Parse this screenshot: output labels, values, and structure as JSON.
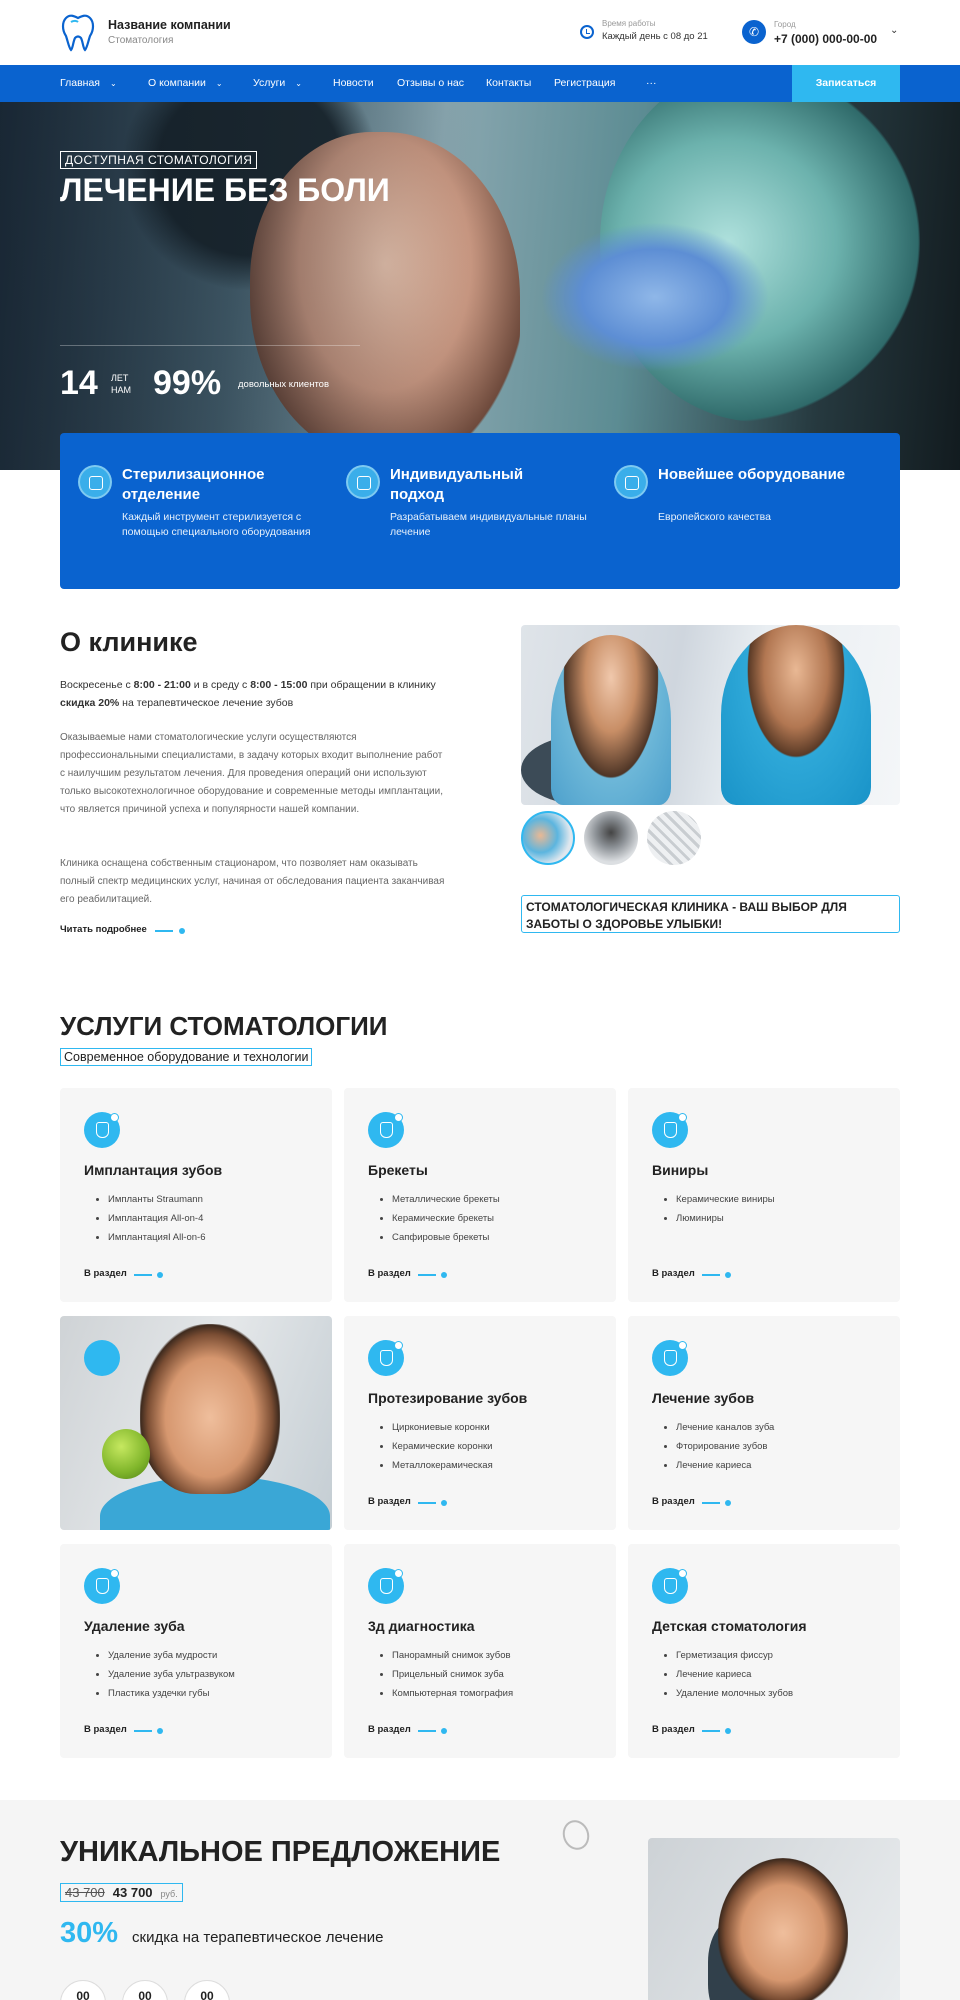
{
  "header": {
    "company_name": "Название компании",
    "company_sub": "Стоматология",
    "hours_label": "Время работы",
    "hours_value": "Каждый день с 08 до 21",
    "city_label": "Город",
    "phone": "+7 (000) 000-00-00"
  },
  "nav": {
    "items": [
      "Главная",
      "О компании",
      "Услуги",
      "Новости",
      "Отзывы о нас",
      "Контакты",
      "Регистрация",
      "···"
    ],
    "cta": "Записаться"
  },
  "hero": {
    "tag": "ДОСТУПНАЯ СТОМАТОЛОГИЯ",
    "title": "ЛЕЧЕНИЕ БЕЗ БОЛИ",
    "stat1_value": "14",
    "stat1_unit_1": "ЛЕТ",
    "stat1_unit_2": "НАМ",
    "stat2_value": "99%",
    "stat2_label": "довольных клиентов"
  },
  "features": [
    {
      "title": "Стерилизационное отделение",
      "desc": "Каждый инструмент стерилизуется с помощью специального оборудования"
    },
    {
      "title": "Индивидуальный подход",
      "desc": "Разрабатываем индивидуальные планы лечение"
    },
    {
      "title": "Новейшее оборудование",
      "desc": "Европейского качества"
    }
  ],
  "about": {
    "title": "О клинике",
    "lead_1": "Воскресенье с ",
    "lead_t1": "8:00 - 21:00",
    "lead_2": " и в среду с ",
    "lead_t2": "8:00 - 15:00",
    "lead_3": " при обращении в клинику ",
    "lead_discount": "скидка 20%",
    "lead_4": " на терапевтическое лечение зубов",
    "p1": "Оказываемые нами стоматологические услуги осуществляются профессиональными специалистами, в задачу которых входит выполнение работ с наилучшим результатом лечения. Для проведения операций они используют только высокотехнологичное оборудование и современные методы имплантации, что является причиной успеха и популярности нашей компании.",
    "p2": "Клиника оснащена собственным стационаром, что позволяет нам оказывать полный спектр медицинских услуг, начиная от обследования пациента заканчивая его реабилитацией.",
    "read_more": "Читать подробнее",
    "slogan": "СТОМАТОЛОГИЧЕСКАЯ КЛИНИКА - ВАШ ВЫБОР ДЛЯ ЗАБОТЫ О ЗДОРОВЬЕ УЛЫБКИ!"
  },
  "services": {
    "title": "УСЛУГИ СТОМАТОЛОГИИ",
    "subtitle": "Современное оборудование и технологии",
    "link_label": "В раздел",
    "cards": [
      {
        "title": "Имплантация зубов",
        "items": [
          "Импланты Straumann",
          "Имплантация All-on-4",
          "ИмплантацияI All-on-6"
        ]
      },
      {
        "title": "Брекеты",
        "items": [
          "Металлические брекеты",
          "Керамические брекеты",
          "Сапфировые брекеты"
        ]
      },
      {
        "title": "Виниры",
        "items": [
          "Керамические виниры",
          "Люминиры"
        ]
      },
      {
        "title": "Протезирование зубов",
        "items": [
          "Циркониевые коронки",
          "Керамические коронки",
          "Металлокерамическая"
        ]
      },
      {
        "title": "Лечение зубов",
        "items": [
          "Лечение каналов зуба",
          "Фторирование зубов",
          "Лечение кариеса"
        ]
      },
      {
        "title": "Удаление зуба",
        "items": [
          "Удаление зуба мудрости",
          "Удаление зуба ультразвуком",
          "Пластика уздечки губы"
        ]
      },
      {
        "title": "3д диагностика",
        "items": [
          "Панорамный снимок зубов",
          "Прицельный снимок зуба",
          "Компьютерная томография"
        ]
      },
      {
        "title": "Детская стоматология",
        "items": [
          "Герметизация фиссур",
          "Лечение кариеса",
          "Удаление молочных зубов"
        ]
      }
    ]
  },
  "offer": {
    "title": "УНИКАЛЬНОЕ ПРЕДЛОЖЕНИЕ",
    "price_old": "43 700",
    "price_new": "43 700",
    "currency": "руб.",
    "percent": "30%",
    "percent_text": "скидка на терапевтическое лечение",
    "timer": [
      "00",
      "00",
      "00"
    ]
  },
  "colors": {
    "primary": "#0a63cf",
    "accent": "#2fb8f0"
  }
}
